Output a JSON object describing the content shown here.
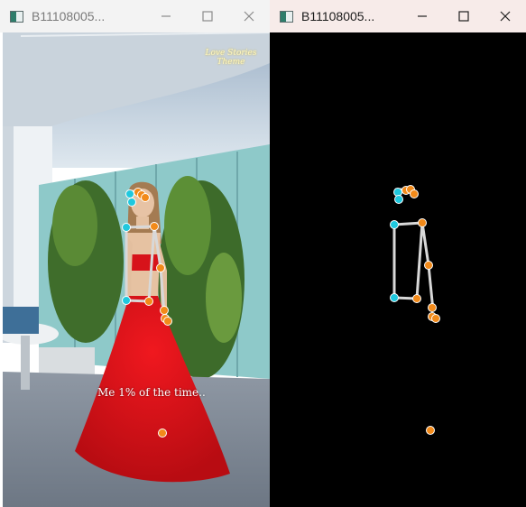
{
  "windows": [
    {
      "id": "video",
      "title": "B11108005...",
      "focused": false,
      "caption": "Me 1% of the time..",
      "watermark": "Love Stories Theme",
      "controls": {
        "minimize": "minimize-icon",
        "maximize": "maximize-icon",
        "close": "close-icon"
      }
    },
    {
      "id": "skeleton",
      "title": "B11108005...",
      "focused": true,
      "controls": {
        "minimize": "minimize-icon",
        "maximize": "maximize-icon",
        "close": "close-icon"
      }
    }
  ],
  "colors": {
    "keypoint_left": "#1fc8de",
    "keypoint_right": "#f28a1a",
    "limb": "#d8d8d8",
    "dress": "#e0121a",
    "skeleton_bg": "#000000"
  }
}
